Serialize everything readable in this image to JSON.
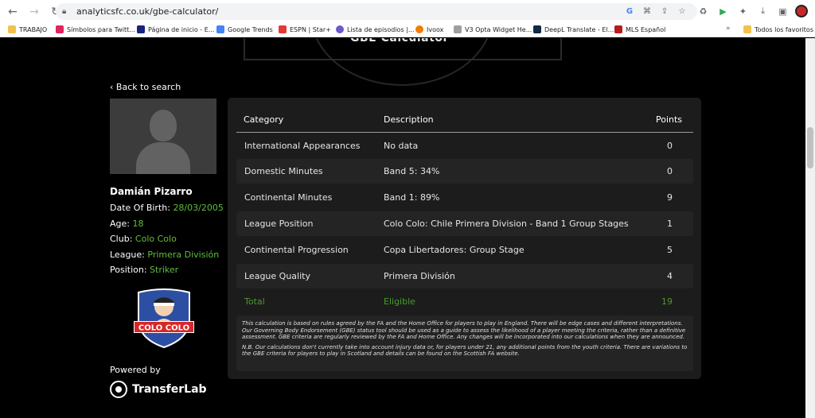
{
  "browser": {
    "url": "analyticsfc.co.uk/gbe-calculator/",
    "bookmarks": [
      "TRABAJO",
      "Símbolos para Twitt...",
      "Página de inicio - E...",
      "Google Trends",
      "ESPN | Star+",
      "Lista de episodios |...",
      "Ivoox",
      "V3 Opta Widget He...",
      "DeepL Translate - El...",
      "MLS Español"
    ],
    "bookmarks_more": "»",
    "all_favorites": "Todos los favoritos"
  },
  "hero": {
    "title": "GBE Calculator"
  },
  "back_link": "Back to search",
  "player": {
    "name": "Damián Pizarro",
    "fields": [
      {
        "label": "Date Of Birth: ",
        "value": "28/03/2005"
      },
      {
        "label": "Age: ",
        "value": "18"
      },
      {
        "label": "Club: ",
        "value": "Colo Colo"
      },
      {
        "label": "League: ",
        "value": "Primera División"
      },
      {
        "label": "Position: ",
        "value": "Striker"
      }
    ],
    "crest_text": "COLO COLO"
  },
  "powered_by": "Powered by",
  "brand": "TransferLab",
  "table": {
    "headers": [
      "Category",
      "Description",
      "Points"
    ],
    "rows": [
      {
        "category": "International Appearances",
        "description": "No data",
        "points": "0"
      },
      {
        "category": "Domestic Minutes",
        "description": "Band 5: 34%",
        "points": "0"
      },
      {
        "category": "Continental Minutes",
        "description": "Band 1: 89%",
        "points": "9"
      },
      {
        "category": "League Position",
        "description": "Colo Colo: Chile Primera Division - Band 1 Group Stages",
        "points": "1"
      },
      {
        "category": "Continental Progression",
        "description": "Copa Libertadores: Group Stage",
        "points": "5"
      },
      {
        "category": "League Quality",
        "description": "Primera División",
        "points": "4"
      }
    ],
    "total": {
      "category": "Total",
      "description": "Eligible",
      "points": "19"
    }
  },
  "notes": [
    "This calculation is based on rules agreed by the FA and the Home Office for players to play in England. There will be edge cases and different interpretations. Our Governing Body Endorsement (GBE) status tool should be used as a guide to assess the likelihood of a player meeting the criteria, rather than a definitive assessment. GBE criteria are regularly reviewed by the FA and Home Office. Any changes will be incorporated into our calculations when they are announced.",
    "N.B. Our calculations don't currently take into account injury data or, for players under 21, any additional points from the youth criteria. There are variations to the GBE criteria for players to play in Scotland and details can be found on the Scottish FA website."
  ],
  "colors": {
    "accent_green": "#5fbf3a",
    "total_green": "#4a9a2e",
    "panel_bg": "#1c1c1c",
    "row_alt_bg": "#242424"
  }
}
